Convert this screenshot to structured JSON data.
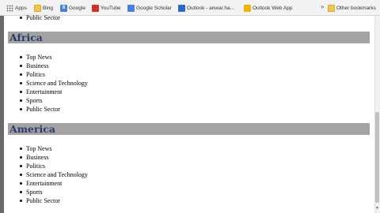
{
  "bookmarks": {
    "items": [
      {
        "label": "Apps",
        "icon": "apps-icon"
      },
      {
        "label": "Bing",
        "icon": "folder-icon"
      },
      {
        "label": "Google",
        "icon": "google-icon"
      },
      {
        "label": "YouTube",
        "icon": "youtube-icon"
      },
      {
        "label": "Google Scholar",
        "icon": "google-scholar-icon"
      },
      {
        "label": "Outlook - anwar.ha...",
        "icon": "outlook-icon"
      },
      {
        "label": "Outlook Web App",
        "icon": "outlook-web-app-icon"
      }
    ],
    "overflow_chevron": "»",
    "other": {
      "label": "Other bookmarks",
      "icon": "folder-icon"
    }
  },
  "top_list": {
    "items": [
      "Public Sector"
    ]
  },
  "sections": [
    {
      "title": "Africa",
      "items": [
        "Top News",
        "Business",
        "Politics",
        "Science and Technology",
        "Entertainment",
        "Sports",
        "Public Sector"
      ]
    },
    {
      "title": "America",
      "items": [
        "Top News",
        "Business",
        "Politics",
        "Science and Technology",
        "Entertainment",
        "Sports",
        "Public Sector"
      ]
    }
  ],
  "colors": {
    "section_bar": "#a3a3a3",
    "section_title": "#2b3a6e",
    "bookmarks_bar": "#f3f3f3"
  }
}
